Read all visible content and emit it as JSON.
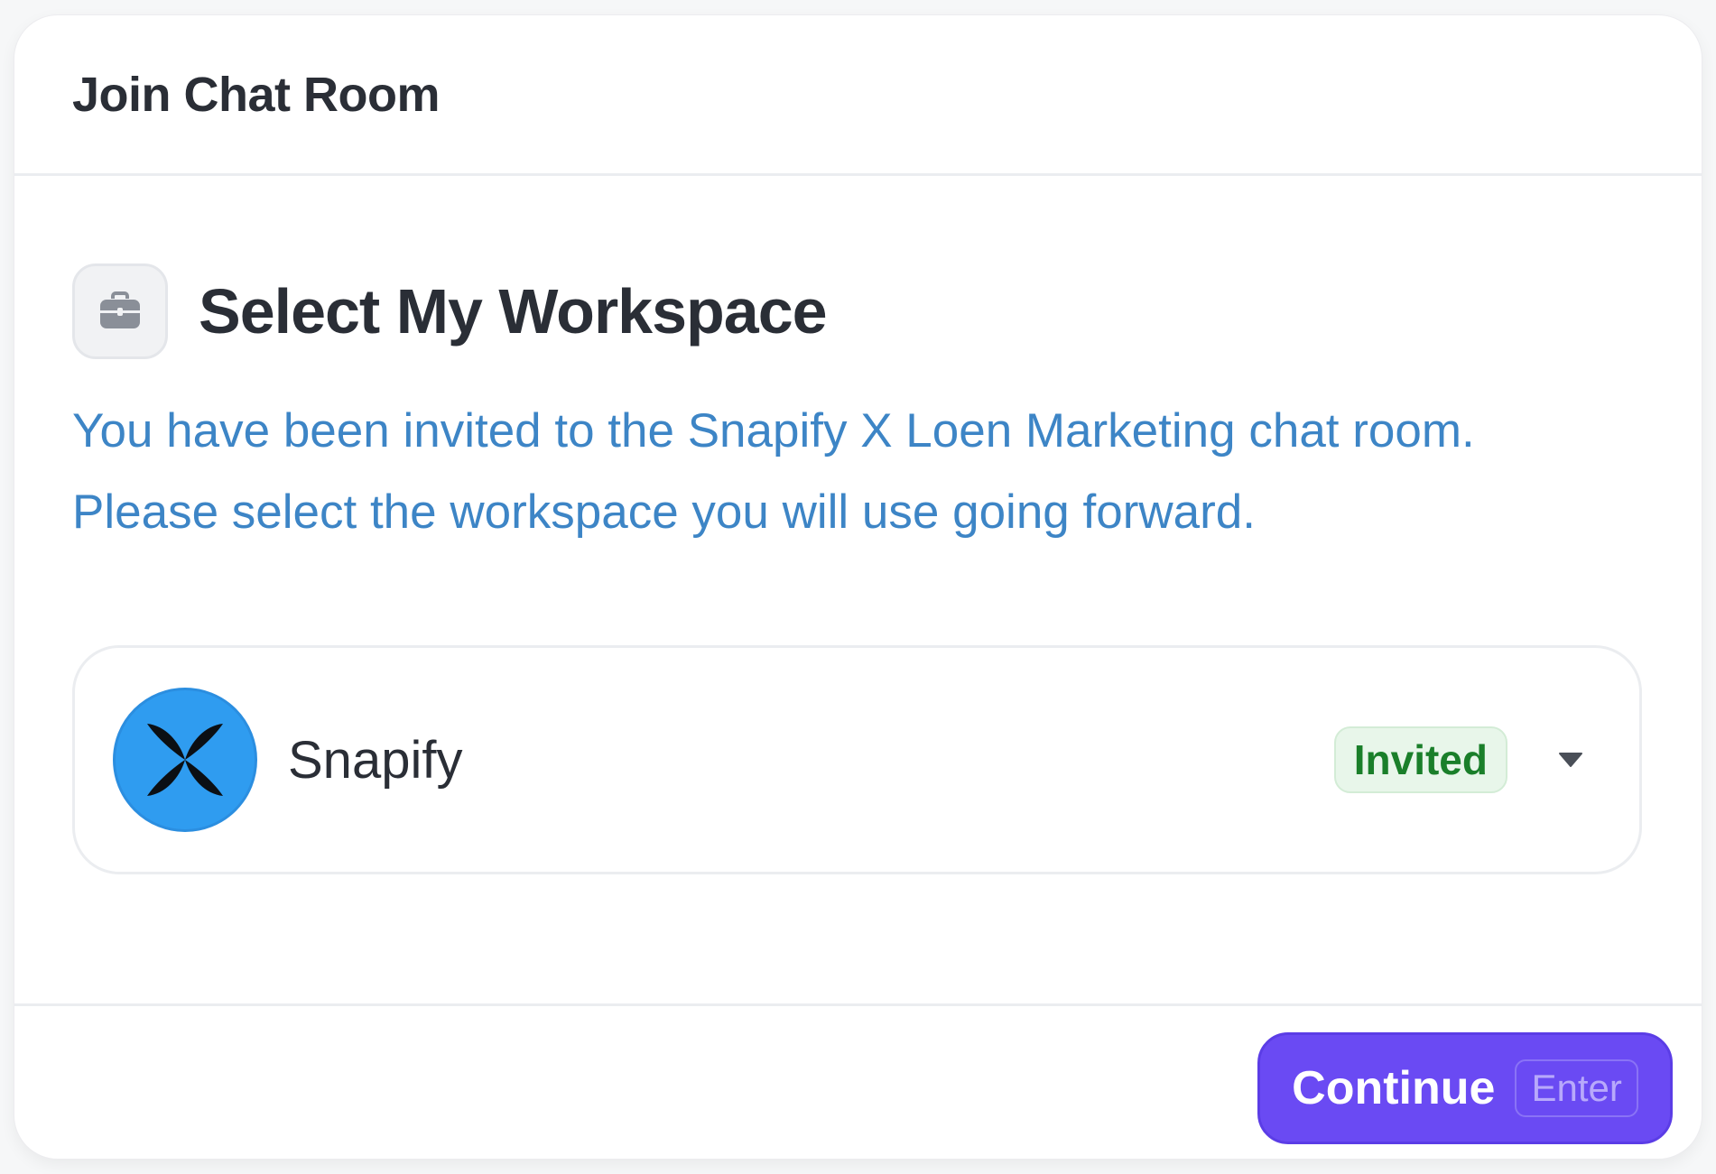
{
  "modal": {
    "title": "Join Chat Room"
  },
  "section": {
    "icon": "briefcase-icon",
    "title": "Select My Workspace",
    "description": "You have been invited to the Snapify X Loen Marketing chat room. Please select the workspace you will use going forward."
  },
  "workspace": {
    "name": "Snapify",
    "logo_icon": "butterfly-x-logo",
    "status": "Invited",
    "caret_icon": "caret-down-icon"
  },
  "footer": {
    "continue_label": "Continue",
    "shortcut": "Enter"
  },
  "colors": {
    "accent": "#6a4af3",
    "link": "#3d85c6",
    "badge_green": "#1a7f2a",
    "avatar_blue": "#2f9cf0"
  }
}
